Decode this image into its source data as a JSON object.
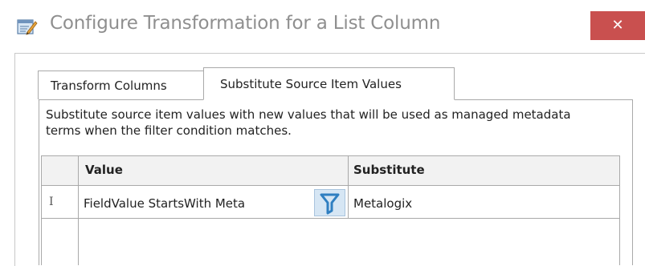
{
  "window": {
    "title": "Configure Transformation for a List Column",
    "close_label": "✕"
  },
  "tabs": [
    {
      "label": "Transform Columns",
      "active": false
    },
    {
      "label": "Substitute Source Item Values",
      "active": true
    }
  ],
  "panel": {
    "description": "Substitute source item values with new values that will be used as managed metadata terms when the filter condition matches."
  },
  "grid": {
    "columns": [
      "Value",
      "Substitute"
    ],
    "rows": [
      {
        "marker": "I",
        "value": "FieldValue StartsWith Meta",
        "substitute": "Metalogix"
      }
    ]
  },
  "colors": {
    "close_button": "#c9504f",
    "filter_icon": "#2f7fc1",
    "header_bg": "#f2f2f2"
  }
}
